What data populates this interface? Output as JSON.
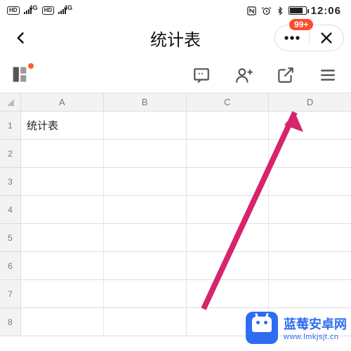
{
  "status": {
    "hd": "HD",
    "net": "4G",
    "time": "12:06"
  },
  "header": {
    "title": "统计表",
    "badge": "99+"
  },
  "sheet": {
    "columns": [
      "A",
      "B",
      "C",
      "D"
    ],
    "rows": [
      {
        "n": "1",
        "cells": [
          "统计表",
          "",
          "",
          ""
        ]
      },
      {
        "n": "2",
        "cells": [
          "",
          "",
          "",
          ""
        ]
      },
      {
        "n": "3",
        "cells": [
          "",
          "",
          "",
          ""
        ]
      },
      {
        "n": "4",
        "cells": [
          "",
          "",
          "",
          ""
        ]
      },
      {
        "n": "5",
        "cells": [
          "",
          "",
          "",
          ""
        ]
      },
      {
        "n": "6",
        "cells": [
          "",
          "",
          "",
          ""
        ]
      },
      {
        "n": "7",
        "cells": [
          "",
          "",
          "",
          ""
        ]
      },
      {
        "n": "8",
        "cells": [
          "",
          "",
          "",
          ""
        ]
      }
    ]
  },
  "watermark": {
    "line1": "蓝莓安卓网",
    "line2": "www.lmkjsjt.cn"
  }
}
